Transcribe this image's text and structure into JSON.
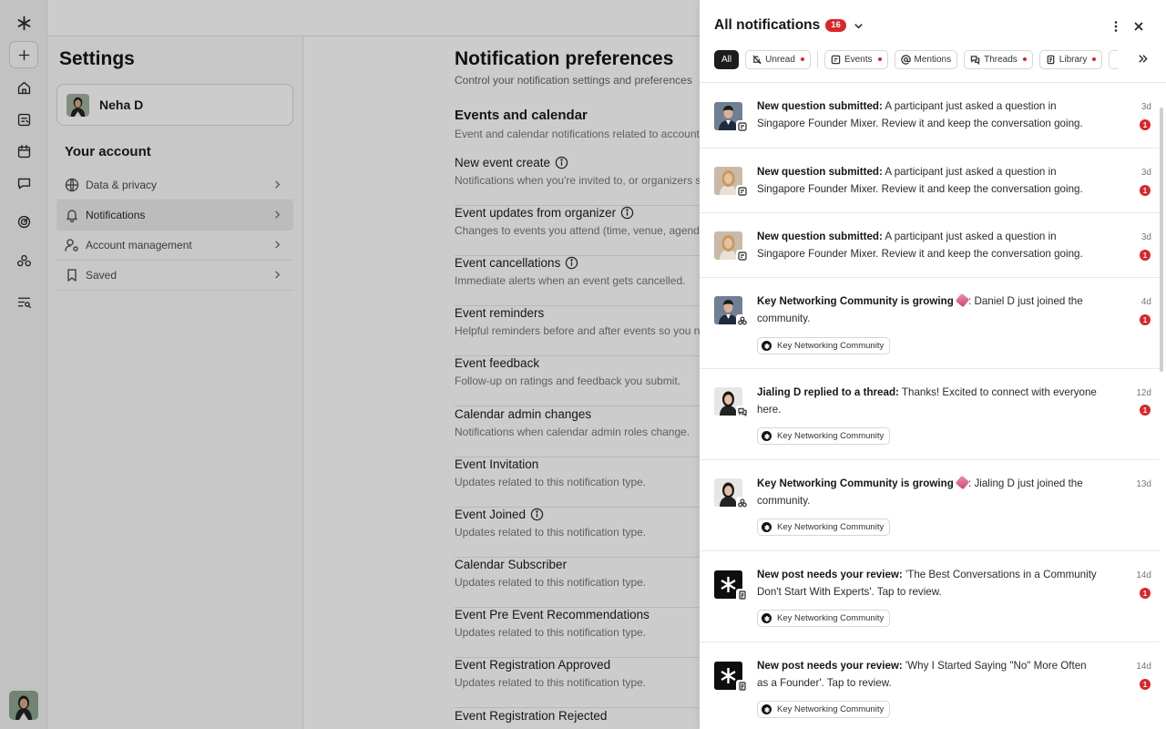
{
  "app": {
    "brand_icon": "asterisk-logo-icon"
  },
  "rail": {
    "items": [
      "plus-icon",
      "home-icon",
      "events-icon",
      "calendar-icon",
      "chat-icon",
      "analytics-icon",
      "community-icon",
      "search-list-icon"
    ]
  },
  "settings": {
    "title": "Settings",
    "profile_name": "Neha D",
    "account_title": "Your account",
    "menu": [
      {
        "label": "Data & privacy",
        "icon": "globe-icon"
      },
      {
        "label": "Notifications",
        "icon": "bell-icon",
        "active": true
      },
      {
        "label": "Account management",
        "icon": "user-settings-icon"
      },
      {
        "label": "Saved",
        "icon": "bookmark-icon"
      }
    ]
  },
  "main": {
    "title": "Notification preferences",
    "subtitle": "Control your notification settings and preferences",
    "section_title": "Events and calendar",
    "section_desc": "Event and calendar notifications related to account",
    "prefs": [
      {
        "title": "New event create",
        "desc": "Notifications when you're invited to, or organizers sc",
        "info": true
      },
      {
        "title": "Event updates from organizer",
        "desc": "Changes to events you attend (time, venue, agenda,",
        "info": true
      },
      {
        "title": "Event cancellations",
        "desc": "Immediate alerts when an event gets cancelled.",
        "info": true
      },
      {
        "title": "Event reminders",
        "desc": "Helpful reminders before and after events so you ne",
        "info": false
      },
      {
        "title": "Event feedback",
        "desc": "Follow-up on ratings and feedback you submit.",
        "info": false
      },
      {
        "title": "Calendar admin changes",
        "desc": "Notifications when calendar admin roles change.",
        "info": false
      },
      {
        "title": "Event Invitation",
        "desc": "Updates related to this notification type.",
        "info": false
      },
      {
        "title": "Event Joined",
        "desc": "Updates related to this notification type.",
        "info": true
      },
      {
        "title": "Calendar Subscriber",
        "desc": "Updates related to this notification type.",
        "info": false
      },
      {
        "title": "Event Pre Event Recommendations",
        "desc": "Updates related to this notification type.",
        "info": false
      },
      {
        "title": "Event Registration Approved",
        "desc": "Updates related to this notification type.",
        "info": false
      },
      {
        "title": "Event Registration Rejected",
        "desc": "",
        "info": false
      }
    ]
  },
  "panel": {
    "title": "All notifications",
    "count": "16",
    "filters": [
      {
        "label": "All",
        "selected": true,
        "dot": false,
        "icon": ""
      },
      {
        "label": "Unread",
        "selected": false,
        "dot": true,
        "icon": "bell-off-icon"
      },
      {
        "label": "Events",
        "selected": false,
        "dot": true,
        "icon": "events-icon"
      },
      {
        "label": "Mentions",
        "selected": false,
        "dot": false,
        "icon": "at-icon"
      },
      {
        "label": "Threads",
        "selected": false,
        "dot": true,
        "icon": "threads-icon"
      },
      {
        "label": "Library",
        "selected": false,
        "dot": true,
        "icon": "library-icon"
      }
    ],
    "notifications": [
      {
        "strong": "New question submitted:",
        "text": " A participant just asked a question in Singapore Founder Mixer. Review it and keep the conversation going.",
        "time": "3d",
        "badge": "1",
        "community": "",
        "avatar": "man",
        "type": "events-icon"
      },
      {
        "strong": "New question submitted:",
        "text": " A participant just asked a question in Singapore Founder Mixer. Review it and keep the conversation going.",
        "time": "3d",
        "badge": "1",
        "community": "",
        "avatar": "woman-blonde",
        "type": "events-icon"
      },
      {
        "strong": "New question submitted:",
        "text": " A participant just asked a question in Singapore Founder Mixer. Review it and keep the conversation going.",
        "time": "3d",
        "badge": "1",
        "community": "",
        "avatar": "woman-blonde",
        "type": "events-icon"
      },
      {
        "strong": "Key Networking Community is growing",
        "emoji": true,
        "text": ": Daniel D just joined the community.",
        "time": "4d",
        "badge": "1",
        "community": "Key Networking Community",
        "avatar": "man",
        "type": "community-icon"
      },
      {
        "strong": "Jialing D replied to a thread:",
        "text": " Thanks! Excited to connect with everyone here.",
        "time": "12d",
        "badge": "1",
        "community": "Key Networking Community",
        "avatar": "woman-dark",
        "type": "threads-icon"
      },
      {
        "strong": "Key Networking Community is growing",
        "emoji": true,
        "text": ": Jialing D just joined the community.",
        "time": "13d",
        "badge": "",
        "community": "Key Networking Community",
        "avatar": "woman-dark",
        "type": "community-icon"
      },
      {
        "strong": "New post needs your review:",
        "text": " 'The Best Conversations in a Community Don't Start With Experts'. Tap to review.",
        "time": "14d",
        "badge": "1",
        "community": "Key Networking Community",
        "avatar": "logo",
        "type": "library-icon"
      },
      {
        "strong": "New post needs your review:",
        "text": " 'Why I Started Saying \"No\" More Often as a Founder'. Tap to review.",
        "time": "14d",
        "badge": "1",
        "community": "Key Networking Community",
        "avatar": "logo",
        "type": "library-icon"
      }
    ]
  }
}
